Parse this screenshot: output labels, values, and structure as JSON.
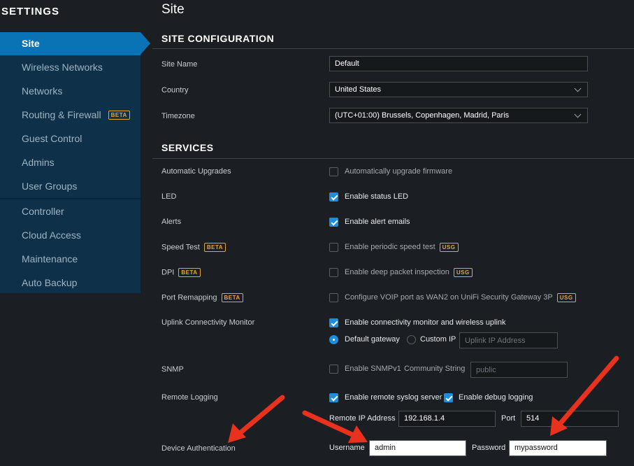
{
  "sidebar": {
    "title": "SETTINGS",
    "items": [
      {
        "label": "Site",
        "active": true
      },
      {
        "label": "Wireless Networks"
      },
      {
        "label": "Networks"
      },
      {
        "label": "Routing & Firewall",
        "badge": "BETA"
      },
      {
        "label": "Guest Control"
      },
      {
        "label": "Admins"
      },
      {
        "label": "User Groups"
      },
      {
        "label": "Controller"
      },
      {
        "label": "Cloud Access"
      },
      {
        "label": "Maintenance"
      },
      {
        "label": "Auto Backup"
      }
    ]
  },
  "page": {
    "title": "Site"
  },
  "site_configuration": {
    "title": "SITE CONFIGURATION",
    "site_name_label": "Site Name",
    "site_name_value": "Default",
    "country_label": "Country",
    "country_value": "United States",
    "timezone_label": "Timezone",
    "timezone_value": "(UTC+01:00) Brussels, Copenhagen, Madrid, Paris"
  },
  "services": {
    "title": "SERVICES",
    "automatic_upgrades": {
      "label": "Automatic Upgrades",
      "option": "Automatically upgrade firmware",
      "checked": false
    },
    "led": {
      "label": "LED",
      "option": "Enable status LED",
      "checked": true
    },
    "alerts": {
      "label": "Alerts",
      "option": "Enable alert emails",
      "checked": true
    },
    "speed_test": {
      "label": "Speed Test",
      "label_badge": "BETA",
      "option": "Enable periodic speed test",
      "option_badge": "USG",
      "checked": false
    },
    "dpi": {
      "label": "DPI",
      "label_badge": "BETA",
      "option": "Enable deep packet inspection",
      "option_badge": "USG",
      "checked": false
    },
    "port_remapping": {
      "label": "Port Remapping",
      "label_badge": "BETA",
      "option": "Configure VOIP port as WAN2 on UniFi Security Gateway 3P",
      "option_badge": "USG",
      "checked": false
    },
    "uplink": {
      "label": "Uplink Connectivity Monitor",
      "option": "Enable connectivity monitor and wireless uplink",
      "checked": true,
      "radio_default": "Default gateway",
      "radio_custom": "Custom IP",
      "selected": "Default gateway",
      "custom_ip_placeholder": "Uplink IP Address"
    },
    "snmp": {
      "label": "SNMP",
      "option": "Enable SNMPv1",
      "checked": false,
      "community_label": "Community String",
      "community_placeholder": "public"
    },
    "remote_logging": {
      "label": "Remote Logging",
      "option": "Enable remote syslog server",
      "checked": true,
      "debug_option": "Enable debug logging",
      "debug_checked": true,
      "ip_label": "Remote IP Address",
      "ip_value": "192.168.1.4",
      "port_label": "Port",
      "port_value": "514"
    },
    "device_auth": {
      "label": "Device Authentication",
      "username_label": "Username",
      "username_value": "admin",
      "password_label": "Password",
      "password_value": "mypassword"
    }
  },
  "colors": {
    "accent": "#0a73b5",
    "checkbox": "#1a8fe0",
    "badge": "#e8a33a",
    "annotation_arrow": "#e8321d"
  }
}
